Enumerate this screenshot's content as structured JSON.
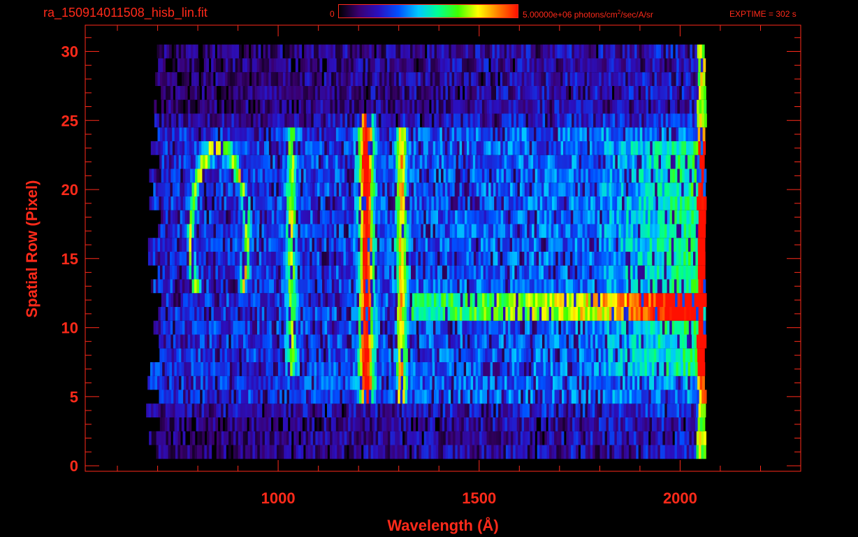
{
  "header": {
    "filename": "ra_150914011508_hisb_lin.fit",
    "colorbar_min": "0",
    "colorbar_max_prefix": "5.00000e+06 photons/cm",
    "colorbar_max_sup": "2",
    "colorbar_max_suffix": "/sec/A/sr",
    "exptime": "EXPTIME = 302 s"
  },
  "colors": {
    "axis": "#ff2a1a",
    "background": "#000000",
    "colormap": [
      "#000000",
      "#3a0070",
      "#2a10c0",
      "#0050ff",
      "#00c8ff",
      "#00ff90",
      "#40ff00",
      "#ffff00",
      "#ff8000",
      "#ff1000"
    ]
  },
  "chart_data": {
    "type": "heatmap",
    "title": "ra_150914011508_hisb_lin.fit",
    "xlabel": "Wavelength (Å)",
    "ylabel": "Spatial Row (Pixel)",
    "xlim": [
      520,
      2300
    ],
    "ylim": [
      -0.4,
      31.9
    ],
    "xticks": [
      1000,
      1500,
      2000
    ],
    "yticks": [
      0,
      5,
      10,
      15,
      20,
      25,
      30
    ],
    "grid": false,
    "colorbar": {
      "min": 0,
      "max": 5000000,
      "units": "photons/cm^2/sec/A/sr"
    },
    "data_extent": {
      "x": [
        690,
        2060
      ],
      "rows": [
        1,
        30
      ]
    },
    "features": [
      {
        "name": "bright vertical line",
        "x": 1216,
        "rows": [
          5,
          25
        ],
        "level": 0.78
      },
      {
        "name": "vertical line",
        "x": 1304,
        "rows": [
          5,
          24
        ],
        "level": 0.5
      },
      {
        "name": "vertical line",
        "x": 1030,
        "rows": [
          7,
          24
        ],
        "level": 0.42
      },
      {
        "name": "arc",
        "x": [
          780,
          920
        ],
        "rows": [
          13,
          23
        ],
        "level": 0.5
      },
      {
        "name": "horizontal band",
        "x": [
          1330,
          2060
        ],
        "rows": [
          11,
          12
        ],
        "level": 0.55
      },
      {
        "name": "edge band",
        "x": [
          2040,
          2060
        ],
        "rows": [
          1,
          30
        ],
        "level": 0.95
      }
    ]
  }
}
